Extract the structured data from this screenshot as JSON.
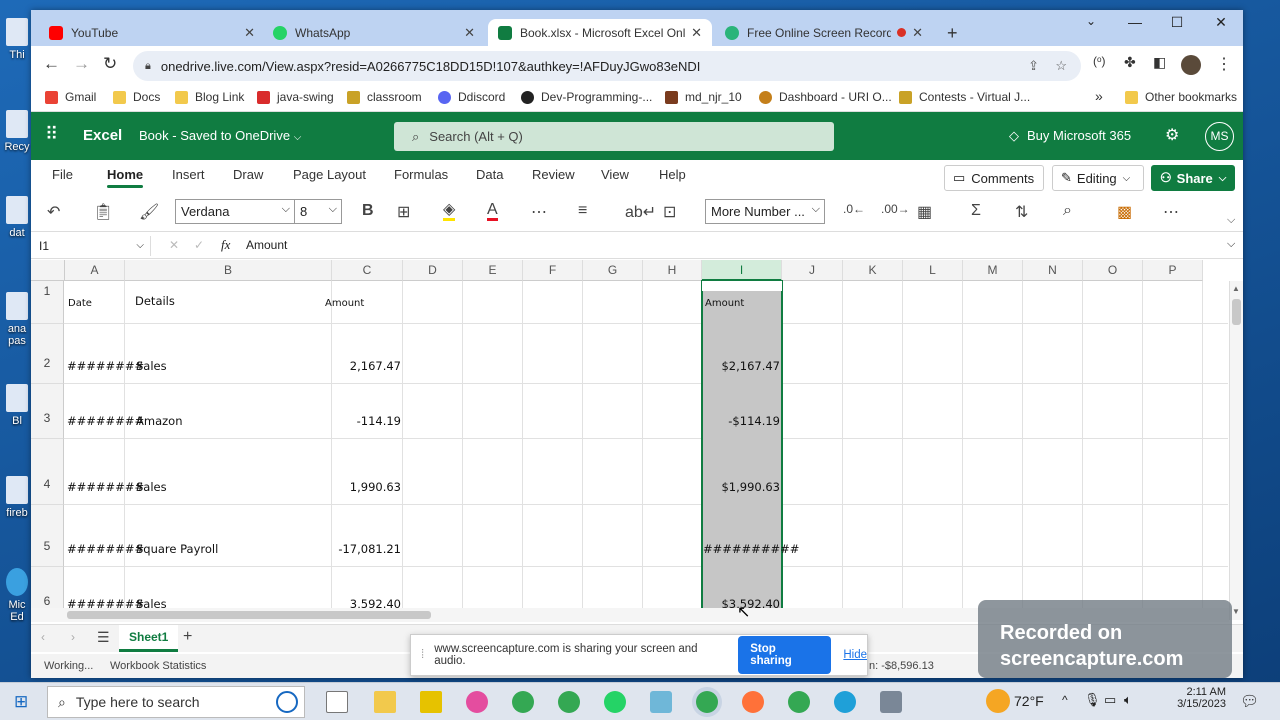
{
  "desktop": {
    "icons": [
      {
        "label": "Thi"
      },
      {
        "label": "Recy"
      },
      {
        "label": "dat"
      },
      {
        "label": "ana\npas"
      },
      {
        "label": "Bl"
      },
      {
        "label": "fireb"
      },
      {
        "label": "Mic\nEd"
      }
    ]
  },
  "browser": {
    "tabs": [
      {
        "title": "YouTube",
        "color": "#ff0000"
      },
      {
        "title": "WhatsApp",
        "color": "#25d366"
      },
      {
        "title": "Book.xlsx - Microsoft Excel Online",
        "color": "#107c41"
      },
      {
        "title": "Free Online Screen Recorder",
        "color": "#2ab47a"
      }
    ],
    "new_tab": "+",
    "url": "onedrive.live.com/View.aspx?resid=A0266775C18DD15D!107&authkey=!AFDuyJGwo83eNDI",
    "bookmarks": [
      {
        "label": "Gmail",
        "color": "#ea4335"
      },
      {
        "label": "Docs",
        "color": "#f2c94c"
      },
      {
        "label": "Blog Link",
        "color": "#f2c94c"
      },
      {
        "label": "java-swing",
        "color": "#d92c2c"
      },
      {
        "label": "classroom",
        "color": "#c9a227"
      },
      {
        "label": "Ddiscord",
        "color": "#5865f2"
      },
      {
        "label": "Dev-Programming-...",
        "color": "#222222"
      },
      {
        "label": "md_njr_10",
        "color": "#7a3b1e"
      },
      {
        "label": "Dashboard - URI O...",
        "color": "#c47f1a"
      },
      {
        "label": "Contests - Virtual J...",
        "color": "#c9a227"
      }
    ],
    "bookmarks_more": "»",
    "other_bookmarks": "Other bookmarks"
  },
  "excel": {
    "app": "Excel",
    "doc_title": "Book",
    "doc_status": "Saved to OneDrive",
    "search_placeholder": "Search (Alt + Q)",
    "buy": "Buy Microsoft 365",
    "avatar": "MS",
    "ribbon_tabs": [
      "File",
      "Home",
      "Insert",
      "Draw",
      "Page Layout",
      "Formulas",
      "Data",
      "Review",
      "View",
      "Help"
    ],
    "comments": "Comments",
    "editing": "Editing",
    "share": "Share",
    "font": "Verdana",
    "font_size": "8",
    "number_format": "More Number ...",
    "name_box": "I1",
    "formula": "Amount",
    "fx": "fx",
    "columns": [
      "A",
      "B",
      "C",
      "D",
      "E",
      "F",
      "G",
      "H",
      "I",
      "J",
      "K",
      "L",
      "M",
      "N",
      "O",
      "P"
    ],
    "rows": [
      {
        "n": "1",
        "a": "Date",
        "b": "Details",
        "c": "Amount",
        "i": "Amount"
      },
      {
        "n": "2",
        "a": "########",
        "b": "Sales",
        "c": "2,167.47",
        "i": "$2,167.47"
      },
      {
        "n": "3",
        "a": "########",
        "b": "Amazon",
        "c": "-114.19",
        "i": "-$114.19"
      },
      {
        "n": "4",
        "a": "########",
        "b": "Sales",
        "c": "1,990.63",
        "i": "$1,990.63"
      },
      {
        "n": "5",
        "a": "########",
        "b": "Square Payroll",
        "c": "-17,081.21",
        "i": "##########"
      },
      {
        "n": "6",
        "a": "########",
        "b": "Sales",
        "c": "3,592.40",
        "i": "$3,592.40"
      }
    ],
    "sheet": "Sheet1",
    "add_sheet": "+",
    "status_left": "Working...",
    "workbook_stats": "Workbook Statistics",
    "sum_fragment": "n: -$8,596.13"
  },
  "share_bar": {
    "text": "www.screencapture.com is sharing your screen and audio.",
    "stop": "Stop sharing",
    "hide": "Hide"
  },
  "watermark": {
    "line1": "Recorded on",
    "line2": "screencapture.com"
  },
  "taskbar": {
    "search": "Type here to search",
    "weather": "72°F",
    "time": "2:11 AM",
    "date": "3/15/2023"
  }
}
